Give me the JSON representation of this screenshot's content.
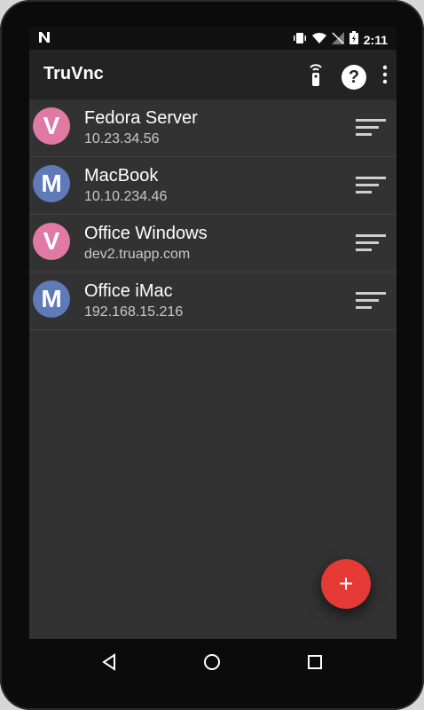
{
  "status_bar": {
    "time": "2:11",
    "icons": [
      "n-badge-icon",
      "vibrate-icon",
      "wifi-icon",
      "signal-off-icon",
      "battery-charging-icon"
    ]
  },
  "app_bar": {
    "title": "TruVnc",
    "actions": [
      "remote-icon",
      "help-icon",
      "overflow-menu-icon"
    ],
    "help_label": "?"
  },
  "connections": [
    {
      "initial": "V",
      "name": "Fedora Server",
      "address": "10.23.34.56",
      "type": "vnc",
      "avatar_color": "#e07aa4"
    },
    {
      "initial": "M",
      "name": "MacBook",
      "address": "10.10.234.46",
      "type": "mac",
      "avatar_color": "#5e7ab8"
    },
    {
      "initial": "V",
      "name": "Office Windows",
      "address": "dev2.truapp.com",
      "type": "vnc",
      "avatar_color": "#e07aa4"
    },
    {
      "initial": "M",
      "name": "Office iMac",
      "address": "192.168.15.216",
      "type": "mac",
      "avatar_color": "#5e7ab8"
    }
  ],
  "fab": {
    "label": "+",
    "color": "#e53935"
  },
  "nav_bar": [
    "back-icon",
    "home-icon",
    "recents-icon"
  ]
}
